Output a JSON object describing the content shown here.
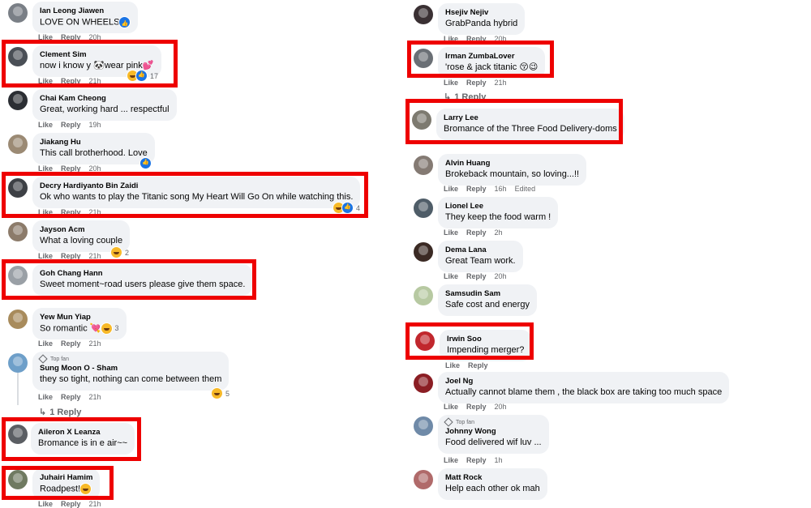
{
  "actions": {
    "like": "Like",
    "reply": "Reply"
  },
  "left": [
    {
      "author": "Ian Leong Jiawen",
      "text": "LOVE ON WHEELS",
      "time": "20h",
      "inline_react": "like",
      "avatar": "#7a7f86"
    },
    {
      "author": "Clement Sim",
      "text": "now i know y 🐼wear pink💕",
      "time": "21h",
      "react_count": "17",
      "avatar": "#4a4f56"
    },
    {
      "author": "Chai Kam Cheong",
      "text": "Great, working hard ... respectful",
      "time": "19h",
      "avatar": "#2b2e33"
    },
    {
      "author": "Jiakang Hu",
      "text": "This call brotherhood. Love",
      "time": "20h",
      "inline_react": "like",
      "avatar": "#9b8a74"
    },
    {
      "author": "Decry Hardiyanto Bin Zaidi",
      "text": "Ok who wants to play the Titanic song My Heart Will Go On while watching this.",
      "time": "21h",
      "react_count": "4",
      "avatar": "#3d4045"
    },
    {
      "author": "Jayson Acm",
      "text": "What a loving couple",
      "time": "21h",
      "react_count": "2",
      "avatar": "#8c7b6a"
    },
    {
      "author": "Goh Chang Hann",
      "text": "Sweet moment~road users please give them space.",
      "time": "",
      "avatar": "#9aa0a6"
    },
    {
      "author": "Yew Mun Yiap",
      "text": "So romantic 💘",
      "time": "21h",
      "react_count": "3",
      "avatar": "#a88b5c"
    },
    {
      "author": "Sung Moon O - Sham",
      "text": "they so tight, nothing can come between them",
      "time": "21h",
      "top_fan": "Top fan",
      "react_count": "5",
      "avatar": "#6e9fc9"
    },
    {
      "author": "Aileron X Leanza",
      "text": "Bromance is in e air~~",
      "time": "",
      "avatar": "#5b5e63"
    },
    {
      "author": "Juhairi Hamim",
      "text": "Roadpest!",
      "time": "21h",
      "avatar": "#6f7a61"
    }
  ],
  "left_reply_link": "1 Reply",
  "right": [
    {
      "author": "Hsejiv Nejiv",
      "text": "GrabPanda hybrid",
      "time": "20h",
      "avatar": "#3a3033"
    },
    {
      "author": "Irman ZumbaLover",
      "text": "'rose & jack titanic 😚😉",
      "time": "21h",
      "avatar": "#6a6f75"
    },
    {
      "author": "Larry Lee",
      "text": "Bromance of the Three Food Delivery-doms",
      "time": "",
      "avatar": "#7d7a70"
    },
    {
      "author": "Alvin Huang",
      "text": "Brokeback mountain, so loving...!!",
      "time": "16h",
      "edited": "Edited",
      "avatar": "#847a73"
    },
    {
      "author": "Lionel Lee",
      "text": "They keep the food warm !",
      "time": "2h",
      "avatar": "#4f5d68"
    },
    {
      "author": "Dema Lana",
      "text": "Great Team work.",
      "time": "20h",
      "avatar": "#3b2a24"
    },
    {
      "author": "Samsudin Sam",
      "text": "Safe cost and energy",
      "time": "",
      "avatar": "#b7c9a2"
    },
    {
      "author": "Irwin Soo",
      "text": "Impending merger?",
      "time": "",
      "avatar": "#c1272d"
    },
    {
      "author": "Joel Ng",
      "text": "Actually cannot blame them , the black box are taking too much space",
      "time": "20h",
      "avatar": "#8b1e24"
    },
    {
      "author": "Johnny Wong",
      "text": "Food delivered wif luv ...",
      "time": "1h",
      "top_fan": "Top fan",
      "avatar": "#6f8aa8"
    },
    {
      "author": "Matt Rock",
      "text": "Help each other ok mah",
      "time": "",
      "avatar": "#b06a6a"
    }
  ],
  "right_reply_link": "1 Reply",
  "highlight_color": "#ee0000"
}
